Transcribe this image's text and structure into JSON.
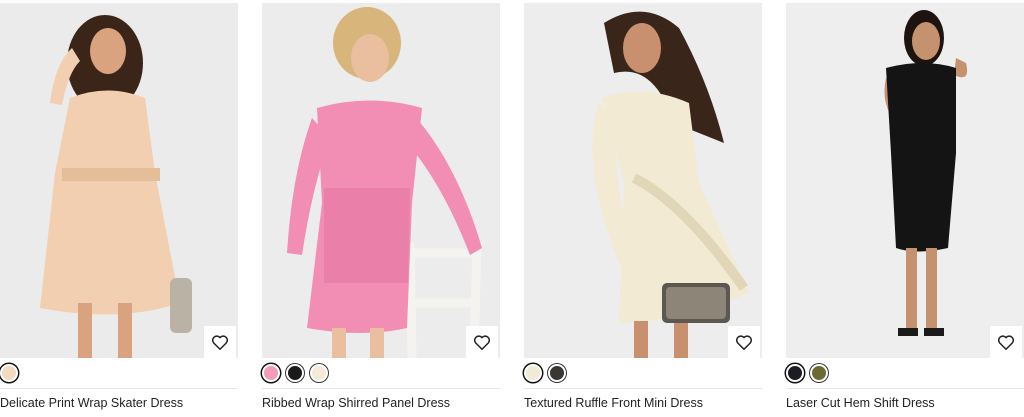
{
  "products": [
    {
      "name": "Delicate Print Wrap Skater Dress",
      "image_desc": "woman in peach wrap skater dress",
      "bg": "#ebebeb",
      "dress_color": "#f1cfb0",
      "swatches": [
        "#f3d9bd"
      ]
    },
    {
      "name": "Ribbed Wrap Shirred Panel Dress",
      "image_desc": "woman in pink ribbed wrap dress",
      "bg": "#ececec",
      "dress_color": "#f28db4",
      "swatches": [
        "#f49bb9",
        "#1a1a1a",
        "#f3ead8"
      ]
    },
    {
      "name": "Textured Ruffle Front Mini Dress",
      "image_desc": "woman in cream satin ruffle mini dress",
      "bg": "#ededed",
      "dress_color": "#f3ead4",
      "swatches": [
        "#f1ead6",
        "#3a3632"
      ]
    },
    {
      "name": "Laser Cut Hem Shift Dress",
      "image_desc": "woman in black laser cut shift dress",
      "bg": "#eeeeee",
      "dress_color": "#141414",
      "swatches": [
        "#1c1c22",
        "#6b6a35"
      ]
    }
  ],
  "icons": {
    "wishlist": "heart-outline-icon"
  }
}
